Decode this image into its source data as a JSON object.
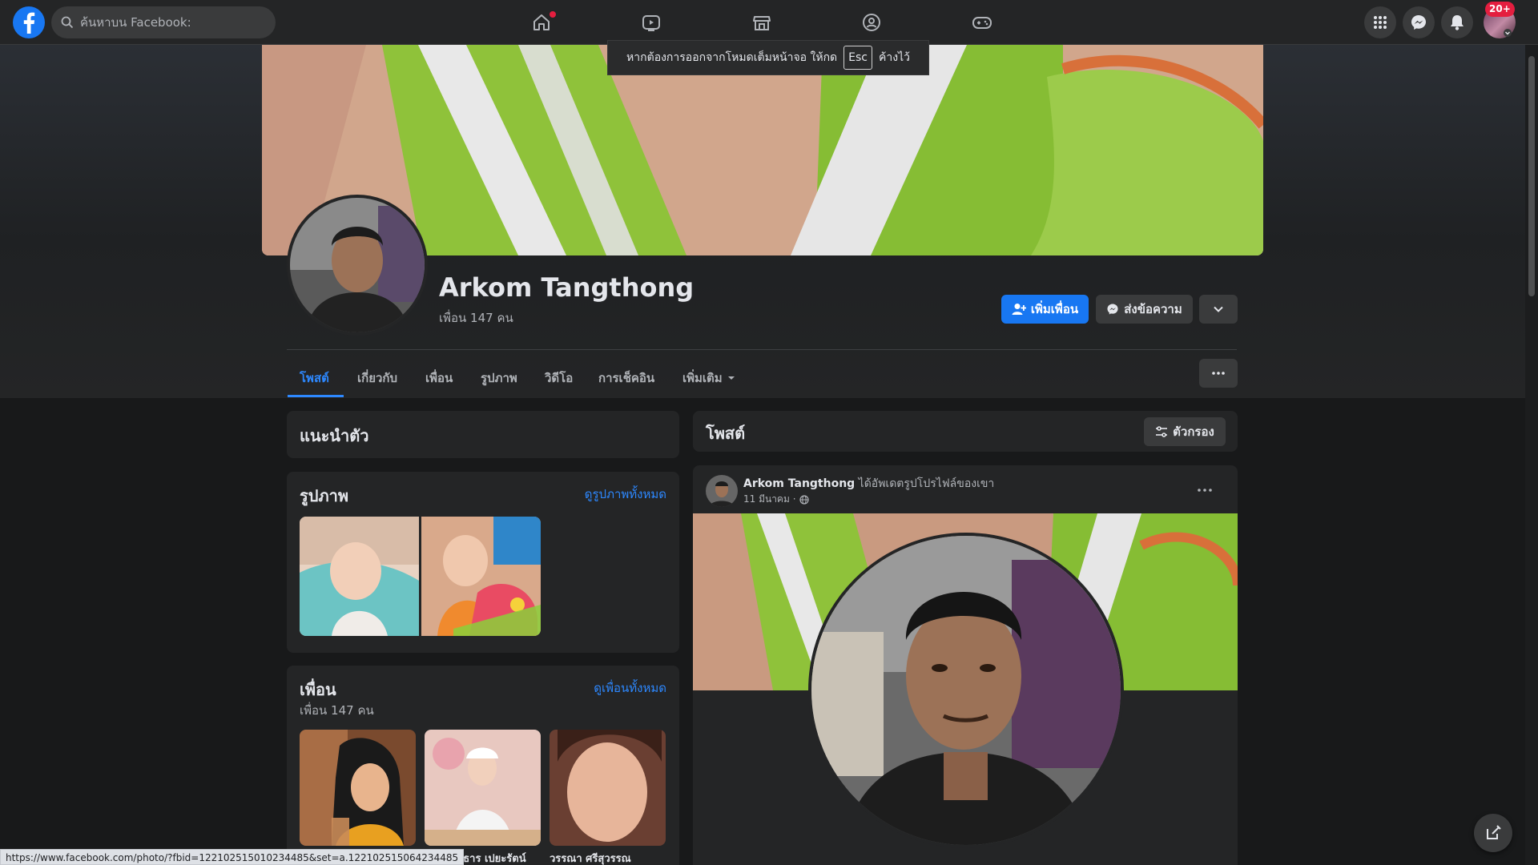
{
  "topbar": {
    "search_placeholder": "ค้นหาบน Facebook:",
    "notification_count": "20+"
  },
  "fullscreen_tip": {
    "before": "หากต้องการออกจากโหมดเต็มหน้าจอ ให้กด",
    "key": "Esc",
    "after": "ค้างไว้"
  },
  "profile": {
    "name": "Arkom Tangthong",
    "friends_count": "เพื่อน 147 คน",
    "add_friend_label": "เพิ่มเพื่อน",
    "message_label": "ส่งข้อความ"
  },
  "tabs": [
    {
      "label": "โพสต์"
    },
    {
      "label": "เกี่ยวกับ"
    },
    {
      "label": "เพื่อน"
    },
    {
      "label": "รูปภาพ"
    },
    {
      "label": "วิดีโอ"
    },
    {
      "label": "การเช็คอิน"
    },
    {
      "label": "เพิ่มเติม"
    }
  ],
  "intro": {
    "title": "แนะนำตัว"
  },
  "photos": {
    "title": "รูปภาพ",
    "see_all": "ดูรูปภาพทั้งหมด"
  },
  "friends": {
    "title": "เพื่อน",
    "count": "เพื่อน 147 คน",
    "see_all": "ดูเพื่อนทั้งหมด",
    "items": [
      {
        "name": ""
      },
      {
        "name": "สิขรินทร์ธาร เปยะรัตน์"
      },
      {
        "name": "วรรณา ศรีสุวรรณ"
      }
    ]
  },
  "posts": {
    "title": "โพสต์",
    "filter_label": "ตัวกรอง",
    "post": {
      "author": "Arkom Tangthong",
      "action": "ได้อัพเดตรูปโปรไฟล์ของเขา",
      "date": "11 มีนาคม ·"
    }
  },
  "statusbar": {
    "url": "https://www.facebook.com/photo/?fbid=122102515010234485&set=a.122102515064234485"
  }
}
